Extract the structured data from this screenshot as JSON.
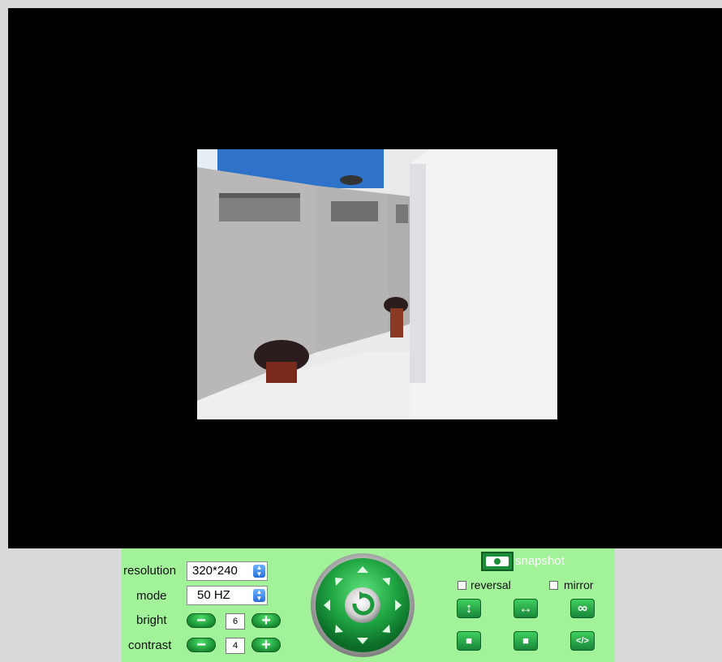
{
  "viewer": {
    "background": "#000000"
  },
  "controls": {
    "resolution": {
      "label": "resolution",
      "value": "320*240"
    },
    "mode": {
      "label": "mode",
      "value": "50 HZ"
    },
    "bright": {
      "label": "bright",
      "value": "6",
      "minus": "−",
      "plus": "+"
    },
    "contrast": {
      "label": "contrast",
      "value": "4",
      "minus": "−",
      "plus": "+"
    },
    "snapshot": {
      "label": "snapshot",
      "icon": "camera-icon"
    },
    "reversal": {
      "label": "reversal",
      "checked": false
    },
    "mirror": {
      "label": "mirror",
      "checked": false
    },
    "buttons": [
      {
        "name": "vertical-patrol",
        "symbol": "↕"
      },
      {
        "name": "horizontal-patrol",
        "symbol": "↔"
      },
      {
        "name": "infinite-patrol",
        "symbol": "∞"
      },
      {
        "name": "stop-left",
        "symbol": "■"
      },
      {
        "name": "stop-middle",
        "symbol": "■"
      },
      {
        "name": "io-toggle",
        "symbol": "</>"
      }
    ]
  },
  "ptz": {
    "center_icon": "rotate-icon",
    "arrows": [
      "up",
      "down",
      "left",
      "right",
      "up-left",
      "up-right",
      "down-left",
      "down-right"
    ]
  },
  "colors": {
    "panel": "#a2f29a",
    "button_green": "#1f9a3a",
    "snapshot_text": "#ffffff"
  }
}
